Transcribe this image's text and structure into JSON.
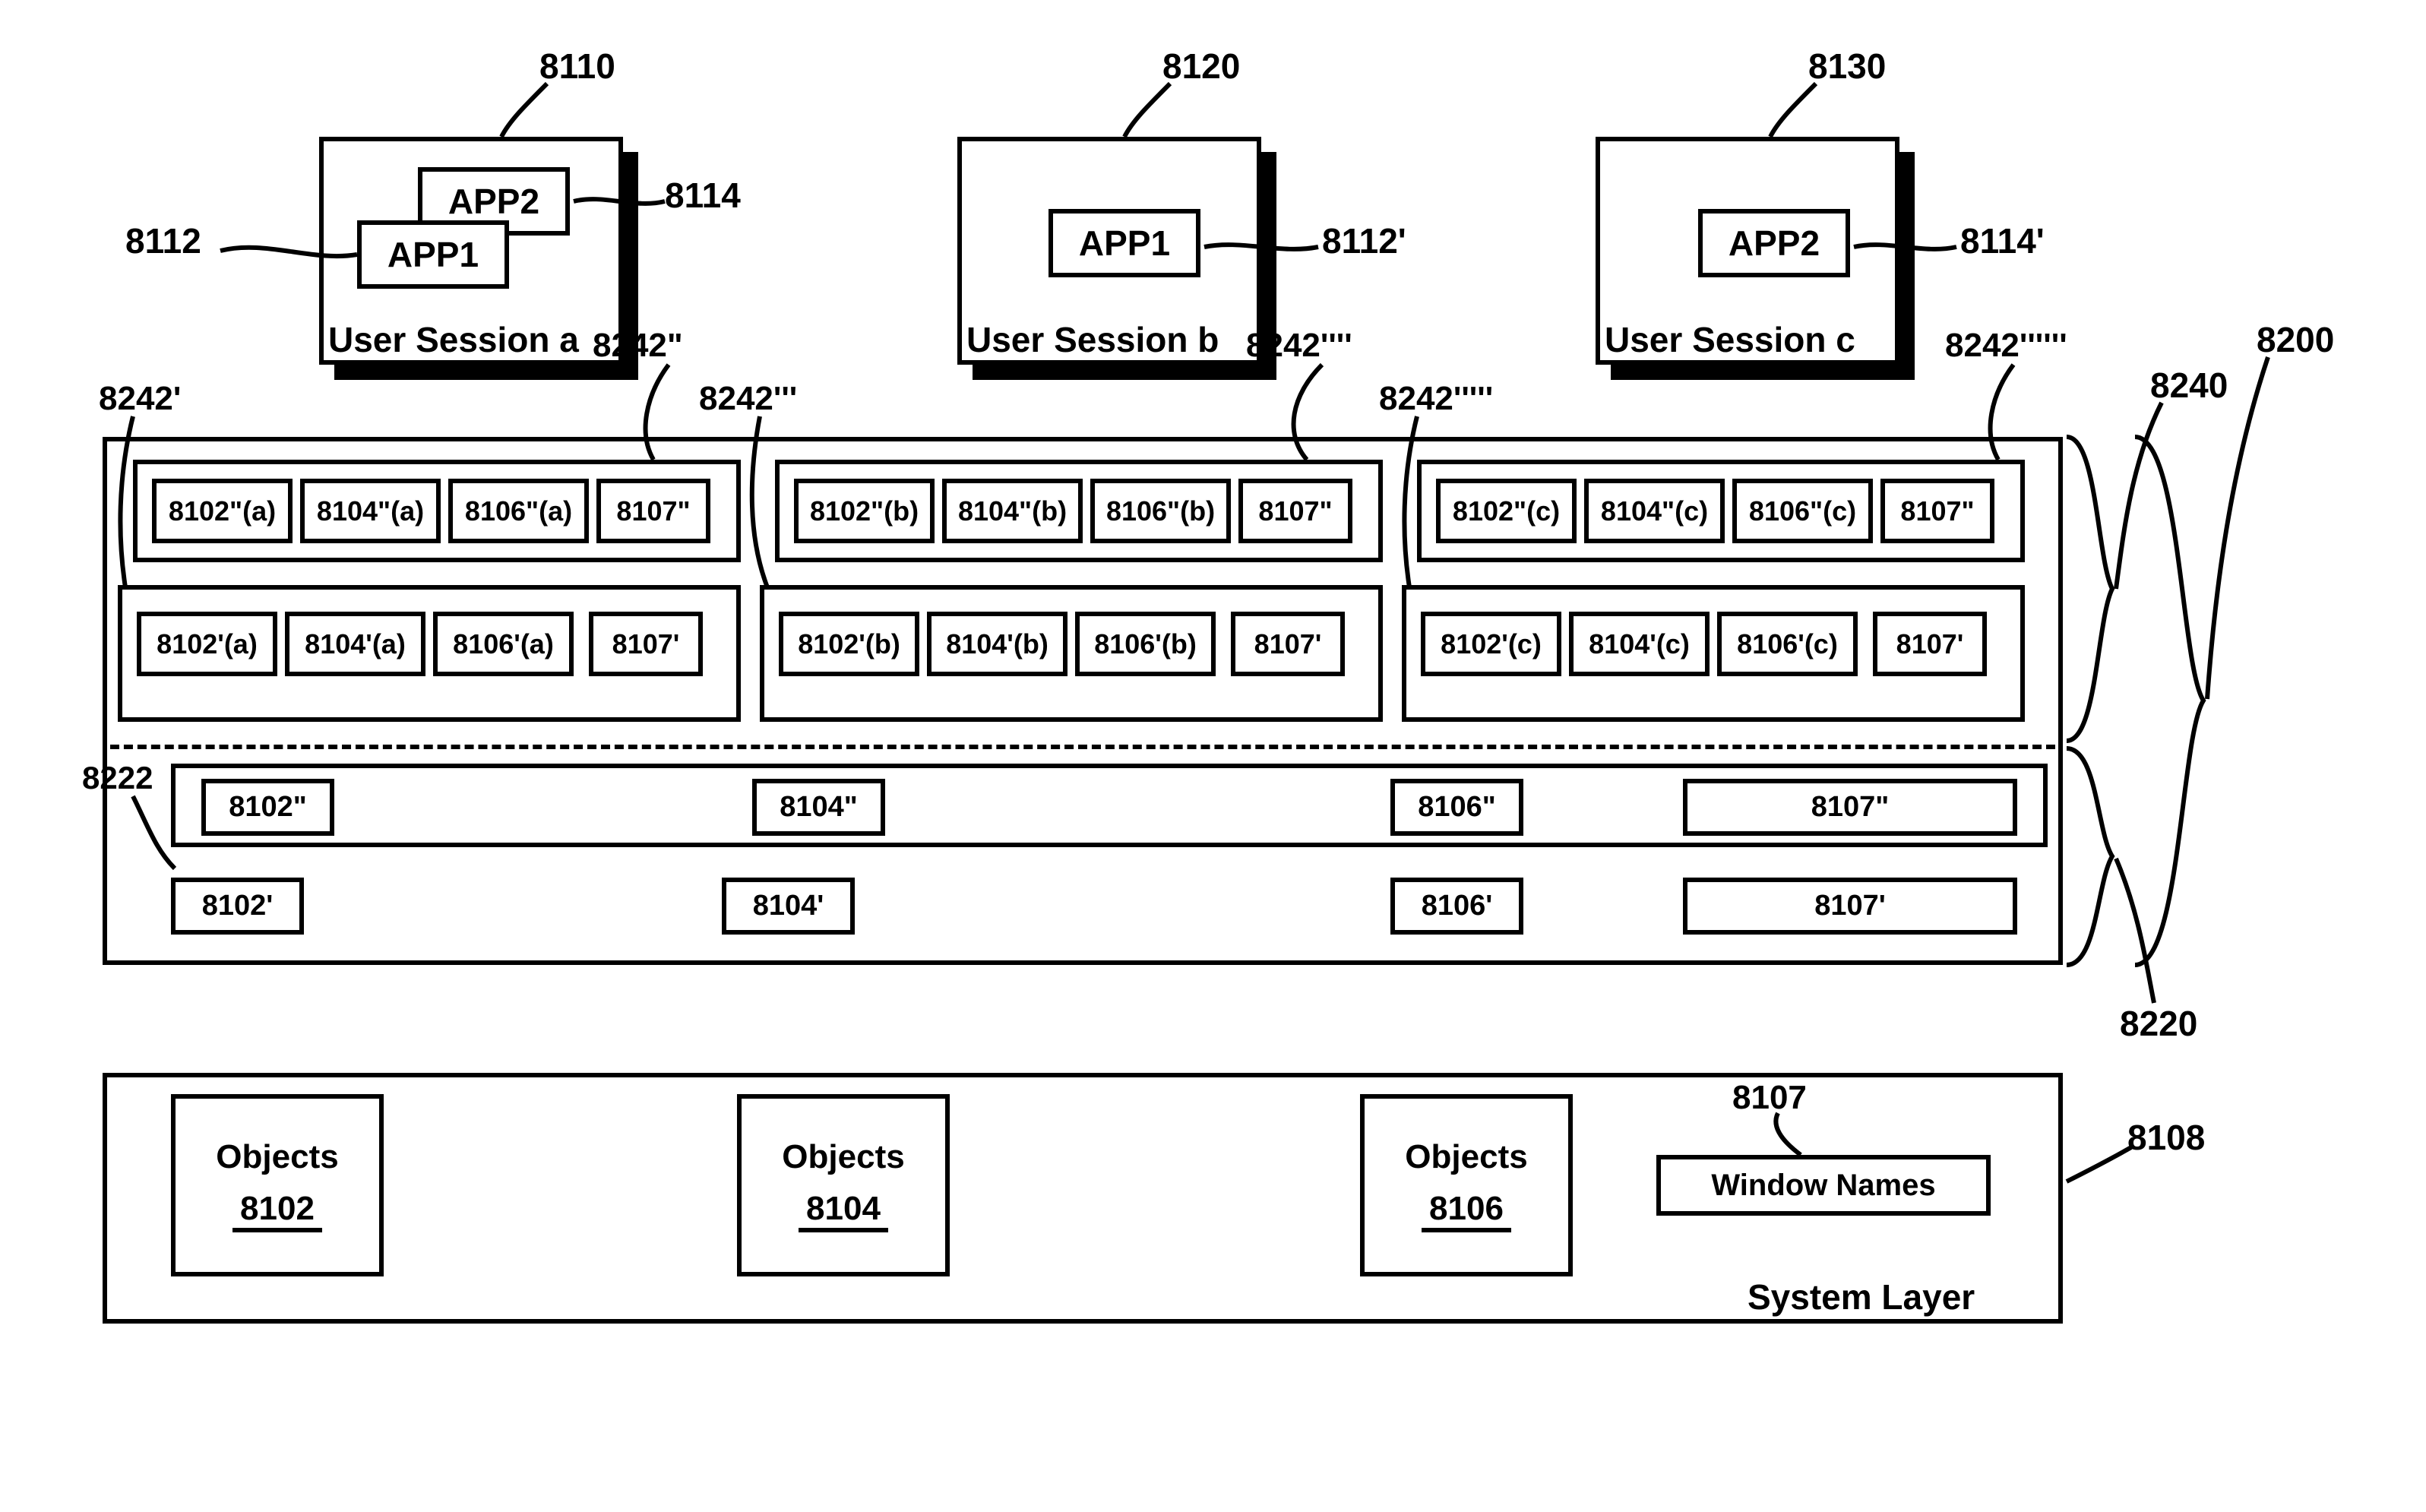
{
  "sessions": {
    "a": {
      "label": "User Session a",
      "ref": "8110",
      "app1": "APP1",
      "app1ref": "8112",
      "app2": "APP2",
      "app2ref": "8114"
    },
    "b": {
      "label": "User Session b",
      "ref": "8120",
      "app1": "APP1",
      "app1ref": "8112'"
    },
    "c": {
      "label": "User Session c",
      "ref": "8130",
      "app2": "APP2",
      "app2ref": "8114'"
    }
  },
  "layer8240": {
    "ref": "8240",
    "group_refs": {
      "r1a": "8242'",
      "r2a": "8242\"",
      "r1b": "8242'''",
      "r2b": "8242''''",
      "r1c": "8242'''''",
      "r2c": "8242''''''"
    },
    "row2": {
      "a": {
        "c1": "8102\"(a)",
        "c2": "8104\"(a)",
        "c3": "8106\"(a)",
        "c4": "8107\""
      },
      "b": {
        "c1": "8102\"(b)",
        "c2": "8104\"(b)",
        "c3": "8106\"(b)",
        "c4": "8107\""
      },
      "c": {
        "c1": "8102\"(c)",
        "c2": "8104\"(c)",
        "c3": "8106\"(c)",
        "c4": "8107\""
      }
    },
    "row1": {
      "a": {
        "c1": "8102'(a)",
        "c2": "8104'(a)",
        "c3": "8106'(a)",
        "c4": "8107'"
      },
      "b": {
        "c1": "8102'(b)",
        "c2": "8104'(b)",
        "c3": "8106'(b)",
        "c4": "8107'"
      },
      "c": {
        "c1": "8102'(c)",
        "c2": "8104'(c)",
        "c3": "8106'(c)",
        "c4": "8107'"
      }
    }
  },
  "layer8220": {
    "ref": "8220",
    "row_ref": "8222",
    "row2": {
      "c1": "8102\"",
      "c2": "8104\"",
      "c3": "8106\"",
      "c4": "8107\""
    },
    "row1": {
      "c1": "8102'",
      "c2": "8104'",
      "c3": "8106'",
      "c4": "8107'"
    }
  },
  "outer_ref": "8200",
  "system": {
    "label": "System Layer",
    "ref": "8108",
    "obj_label": "Objects",
    "o1": "8102",
    "o2": "8104",
    "o3": "8106",
    "win_label": "Window Names",
    "win_ref": "8107"
  }
}
